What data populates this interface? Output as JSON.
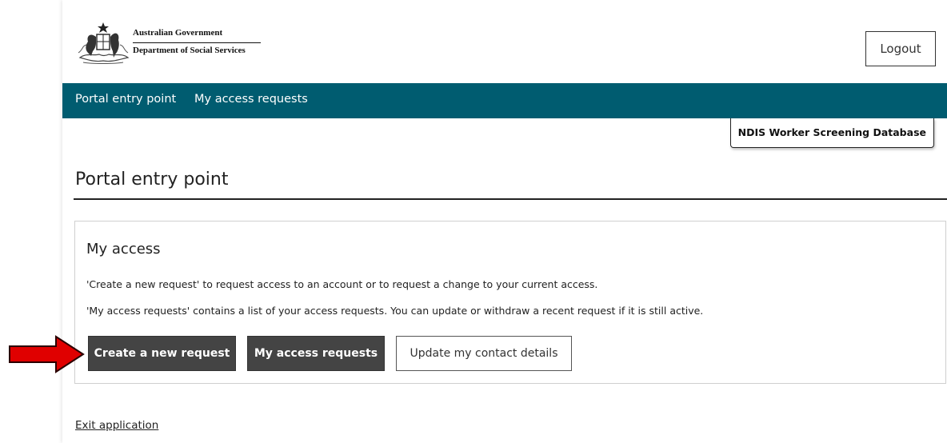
{
  "header": {
    "agency_line1": "Australian Government",
    "agency_line2": "Department of Social Services",
    "logout_label": "Logout"
  },
  "nav": {
    "items": [
      {
        "label": "Portal entry point"
      },
      {
        "label": "My access requests"
      }
    ]
  },
  "database_tag": "NDIS Worker Screening Database",
  "page": {
    "title": "Portal entry point"
  },
  "panel": {
    "title": "My access",
    "paragraph1": "'Create a new request' to request access to an account or to request a change to your current access.",
    "paragraph2": "'My access requests' contains a list of your access requests. You can update or withdraw a recent request if it is still active.",
    "buttons": {
      "create": "Create a new request",
      "requests": "My access requests",
      "update": "Update my contact details"
    }
  },
  "footer": {
    "exit_label": "Exit application"
  },
  "colors": {
    "nav_bg": "#005c70",
    "dark_button": "#444444",
    "annotation_arrow": "#e00000"
  },
  "icons": {
    "logo": "australian-coat-of-arms-icon",
    "arrow": "red-arrow-annotation-icon"
  }
}
